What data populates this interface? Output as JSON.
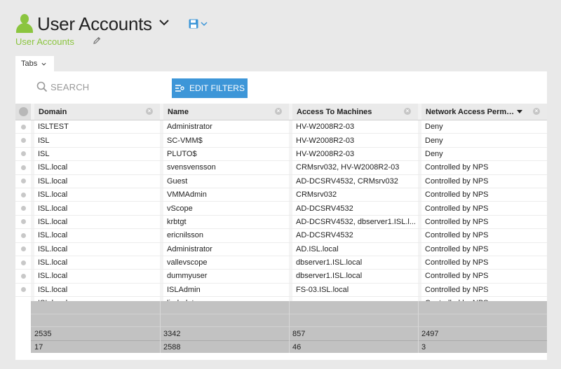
{
  "header": {
    "title": "User Accounts",
    "subtitle": "User Accounts"
  },
  "tabs": {
    "label": "Tabs"
  },
  "search": {
    "placeholder": "SEARCH"
  },
  "toolbar": {
    "edit_filters_label": "EDIT FILTERS"
  },
  "colors": {
    "accent_green": "#8bc53f",
    "button_blue": "#3d96d8"
  },
  "grid": {
    "columns": [
      "Domain",
      "Name",
      "Access To Machines",
      "Network Access Perm…"
    ],
    "sort_column": "Network Access Perm…",
    "rows": [
      [
        "ISLTEST",
        "Administrator",
        "HV-W2008R2-03",
        "Deny"
      ],
      [
        "ISL",
        "SC-VMM$",
        "HV-W2008R2-03",
        "Deny"
      ],
      [
        "ISL",
        "PLUTO$",
        "HV-W2008R2-03",
        "Deny"
      ],
      [
        "ISL.local",
        "svensvensson",
        "CRMsrv032, HV-W2008R2-03",
        "Controlled by NPS"
      ],
      [
        "ISL.local",
        "Guest",
        "AD-DCSRV4532, CRMsrv032",
        "Controlled by NPS"
      ],
      [
        "ISL.local",
        "VMMAdmin",
        "CRMsrv032",
        "Controlled by NPS"
      ],
      [
        "ISL.local",
        "vScope",
        "AD-DCSRV4532",
        "Controlled by NPS"
      ],
      [
        "ISL.local",
        "krbtgt",
        "AD-DCSRV4532, dbserver1.ISL.l...",
        "Controlled by NPS"
      ],
      [
        "ISL.local",
        "ericnilsson",
        "AD-DCSRV4532",
        "Controlled by NPS"
      ],
      [
        "ISL.local",
        "Administrator",
        "AD.ISL.local",
        "Controlled by NPS"
      ],
      [
        "ISL.local",
        "vallevscope",
        "dbserver1.ISL.local",
        "Controlled by NPS"
      ],
      [
        "ISL.local",
        "dummyuser",
        "dbserver1.ISL.local",
        "Controlled by NPS"
      ],
      [
        "ISL.local",
        "ISLAdmin",
        "FS-03.ISL.local",
        "Controlled by NPS"
      ],
      [
        "ISL.local",
        "lindadata",
        "",
        "Controlled by NPS"
      ]
    ],
    "summary": [
      [
        "2535",
        "3342",
        "857",
        "2497"
      ],
      [
        "17",
        "2588",
        "46",
        "3"
      ]
    ]
  }
}
